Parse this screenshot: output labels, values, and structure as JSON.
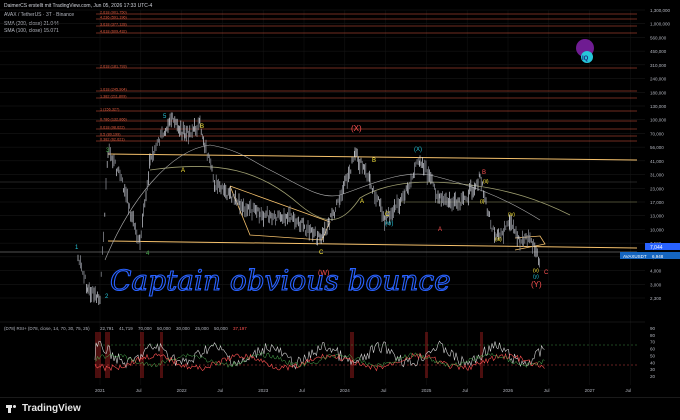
{
  "header": {
    "author_line": "DaimerCS erstellt mit TradingView.com, Jun 05, 2026 17:33 UTC-4",
    "symbol_line": "AVAX / TetherUS · 3T · Binance",
    "sma200_label": "SMA (200, close) 21.044",
    "sma100_label": "SMA (100, close) 15.071"
  },
  "price_axis": {
    "labels": [
      "1,300,000",
      "1,000,000",
      "560,000",
      "450,000",
      "310,000",
      "240,000",
      "180,000",
      "130,000",
      "100,000",
      "70,000",
      "56,000",
      "41,000",
      "31,000",
      "23,000",
      "17,000",
      "13,000",
      "10,000",
      "7,500",
      "5,500",
      "4,000",
      "3,000",
      "2,300"
    ],
    "last_price": "7,044",
    "ticker_badge": "AVAXUSDT",
    "ticker_price": "6,948"
  },
  "rsi_axis": {
    "labels": [
      "90",
      "80",
      "70",
      "60",
      "50",
      "40",
      "30",
      "20"
    ]
  },
  "rsi_header": "(D78) RSI+ (D78, close, 14, 70, 30, 75, 25)",
  "rsi_values": [
    "22,791",
    "41,719",
    "70,000",
    "50,000",
    "30,000",
    "25,000",
    "50,000",
    "37,197"
  ],
  "time_axis": {
    "labels": [
      "2021",
      "Jul",
      "2022",
      "Jul",
      "2023",
      "Jul",
      "2024",
      "Jul",
      "2025",
      "Jul",
      "2026",
      "Jul",
      "2027",
      "Jul"
    ]
  },
  "fib_levels": [
    "2.618 (901,750)",
    "4.236 (591,196)",
    "3.618 (377,128)",
    "4.618 (609,432)",
    "2.618 (181,793)",
    "1.618 (245,904)",
    "1.382 (211,809)",
    "1 (156,327)",
    "0.786 (132,866)",
    "0.618 (98,622)",
    "0.5 (80,199)",
    "0.382 (62,621)"
  ],
  "wave_labels": {
    "w1": "1",
    "w2": "2",
    "w3": "3",
    "w4": "4",
    "w5": "5",
    "wA_top": "B",
    "wA": "A",
    "wX": "(X)",
    "wB": "B",
    "wC1": "C",
    "wW": "(W)",
    "wA2": "A",
    "wB2": "B",
    "wC2": "C",
    "wX2": "(X)",
    "w_w": "(w)",
    "w_x": "(x)",
    "w_y": "(y)",
    "w_i": "(i)",
    "w_ii": "(ii)",
    "w_iii": "(iii)",
    "w_iv": "(iv)",
    "w_v": "(v)",
    "wY": "(Y)",
    "wC3": "C",
    "wA3": "A"
  },
  "annotation": "Captain obvious bounce",
  "footer": {
    "brand": "TradingView"
  },
  "colors": {
    "fib": "#e05a3f",
    "channel": "#f5c16c",
    "wave_green": "#4caf50",
    "wave_yellow": "#ffeb3b",
    "wave_cyan": "#26c6da",
    "wave_red": "#ff5252",
    "handwriting": "#2962ff",
    "rsi_line": "#e0e0e0",
    "sma": "#8bc34a"
  }
}
